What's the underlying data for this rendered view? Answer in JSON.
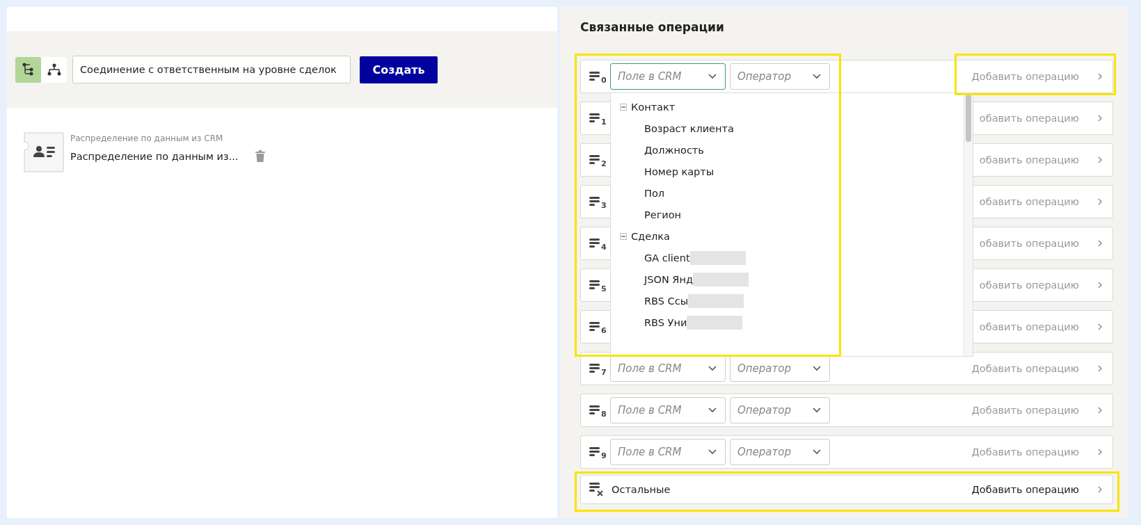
{
  "toolbar": {
    "view_toggles": [
      {
        "kind": "tree",
        "selected": true
      },
      {
        "kind": "hierarchy",
        "selected": false
      }
    ],
    "name_input": {
      "value": "Соединение с ответственным на уровне сделок"
    },
    "create_button": "Создать"
  },
  "blocks": [
    {
      "caption": "Распределение по данным из CRM",
      "title": "Распределение по данным из..."
    }
  ],
  "related": {
    "title": "Связанные операции",
    "rows": [
      {
        "kind": "condition",
        "number": "0",
        "field": "Поле в CRM",
        "operator": "Оператор",
        "field_open": true,
        "add": "Добавить операцию"
      },
      {
        "kind": "condition",
        "number": "1",
        "add": "обавить операцию"
      },
      {
        "kind": "condition",
        "number": "2",
        "add": "обавить операцию"
      },
      {
        "kind": "condition",
        "number": "3",
        "add": "обавить операцию"
      },
      {
        "kind": "condition",
        "number": "4",
        "add": "обавить операцию"
      },
      {
        "kind": "condition",
        "number": "5",
        "add": "обавить операцию"
      },
      {
        "kind": "condition",
        "number": "6",
        "add": "обавить операцию"
      },
      {
        "kind": "condition",
        "number": "7",
        "field": "Поле в CRM",
        "operator": "Оператор",
        "field_open": false,
        "add": "Добавить операцию"
      },
      {
        "kind": "condition",
        "number": "8",
        "field": "Поле в CRM",
        "operator": "Оператор",
        "field_open": false,
        "add": "Добавить операцию"
      },
      {
        "kind": "condition",
        "number": "9",
        "field": "Поле в CRM",
        "operator": "Оператор",
        "field_open": false,
        "add": "Добавить операцию"
      },
      {
        "kind": "fallback",
        "label": "Остальные",
        "add": "Добавить операцию"
      }
    ],
    "field_dropdown": {
      "groups": [
        {
          "label": "Контакт",
          "expanded": true,
          "children": [
            {
              "label": "Возраст клиента"
            },
            {
              "label": "Должность"
            },
            {
              "label": "Номер карты"
            },
            {
              "label": "Пол"
            },
            {
              "label": "Регион"
            }
          ]
        },
        {
          "label": "Сделка",
          "expanded": true,
          "children": [
            {
              "label": "GA client",
              "redacted": true
            },
            {
              "label": "JSON Янд",
              "redacted": true
            },
            {
              "label": "RBS Ссы",
              "redacted": true
            },
            {
              "label": "RBS Уни",
              "redacted": true
            }
          ]
        }
      ]
    }
  }
}
